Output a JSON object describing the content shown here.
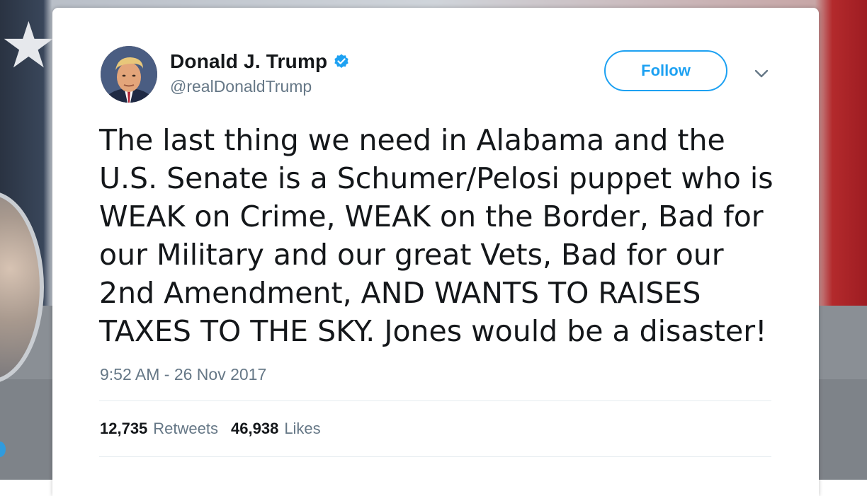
{
  "profile": {
    "display_name": "Donald J. Trump",
    "handle": "@realDonaldTrump",
    "verified": true,
    "avatar_icon": "profile-photo"
  },
  "actions": {
    "follow_label": "Follow",
    "more_icon": "chevron-down-icon"
  },
  "tweet": {
    "text": "The last thing we need in Alabama and the\nU.S. Senate is a Schumer/Pelosi puppet who is\nWEAK on Crime, WEAK on the Border, Bad for\nour Military and our great Vets, Bad for our\n2nd Amendment, AND WANTS TO RAISES\nTAXES TO THE SKY. Jones would be a disaster!",
    "timestamp": "9:52 AM - 26 Nov 2017"
  },
  "stats": {
    "retweets_count": "12,735",
    "retweets_label": "Retweets",
    "likes_count": "46,938",
    "likes_label": "Likes"
  },
  "colors": {
    "accent": "#1da1f2",
    "text_primary": "#14171a",
    "text_secondary": "#657786",
    "divider": "#e6ecf0"
  }
}
